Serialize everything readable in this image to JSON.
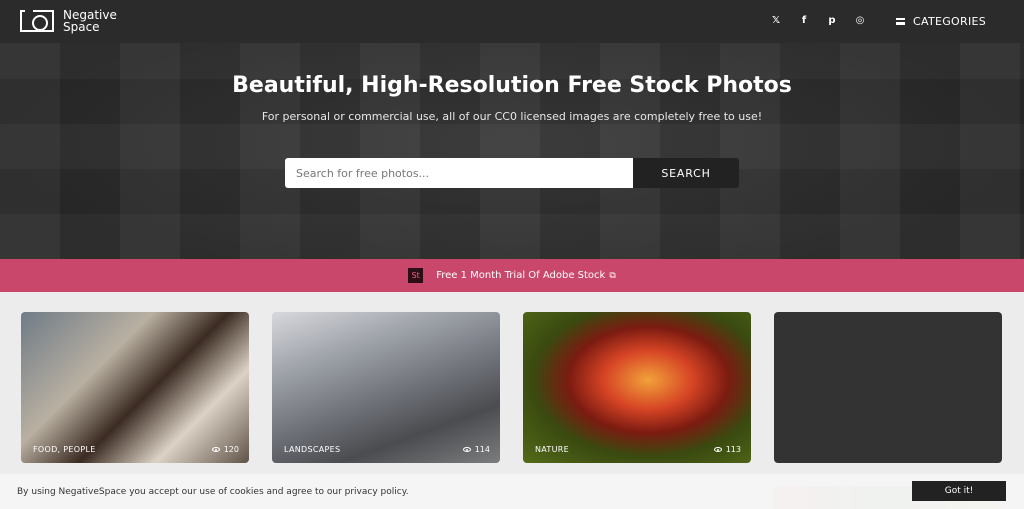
{
  "brand": {
    "line1": "Negative",
    "line2": "Space"
  },
  "nav": {
    "social": [
      {
        "name": "twitter-icon",
        "glyph": "𝕏"
      },
      {
        "name": "facebook-icon",
        "glyph": "f"
      },
      {
        "name": "pinterest-icon",
        "glyph": "p"
      },
      {
        "name": "instagram-icon",
        "glyph": "◎"
      }
    ],
    "categories_label": "CATEGORIES"
  },
  "hero": {
    "title": "Beautiful, High-Resolution Free Stock Photos",
    "subtitle": "For personal or commercial use, all of our CC0 licensed images are completely free to use!",
    "search_placeholder": "Search for free photos...",
    "search_button": "SEARCH"
  },
  "promo": {
    "badge": "St",
    "text": "Free 1 Month Trial Of Adobe Stock"
  },
  "cards": [
    {
      "label": "FOOD, PEOPLE",
      "views": "120"
    },
    {
      "label": "LANDSCAPES",
      "views": "114"
    },
    {
      "label": "NATURE",
      "views": "113"
    },
    {
      "label": "",
      "views": ""
    }
  ],
  "cookie": {
    "text": "By using NegativeSpace you accept our use of cookies and agree to our privacy policy.",
    "button": "Got it!"
  },
  "colors": {
    "promo": "#c9476b",
    "header": "#2b2b2b"
  }
}
